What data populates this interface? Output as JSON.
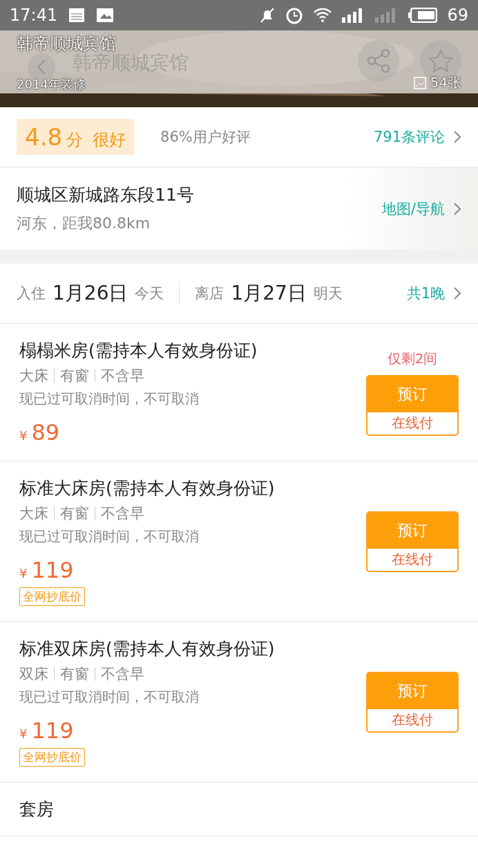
{
  "status_bar": {
    "time": "17:41",
    "battery": "69"
  },
  "header": {
    "hotel_name": "韩帝顺城宾馆",
    "renovated": "2014年装修",
    "title": "韩帝顺城宾馆",
    "photo_count": "54张"
  },
  "rating": {
    "score": "4.8",
    "unit": "分",
    "verdict": "很好",
    "positive": "86%用户好评",
    "reviews": "791条评论"
  },
  "address": {
    "street": "顺城区新城路东段11号",
    "area": "河东，距我80.8km",
    "map_link": "地图/导航"
  },
  "dates": {
    "checkin_label": "入住",
    "checkin_date": "1月26日",
    "checkin_day": "今天",
    "checkout_label": "离店",
    "checkout_date": "1月27日",
    "checkout_day": "明天",
    "nights": "共1晚"
  },
  "rooms": [
    {
      "name": "榻榻米房(需持本人有效身份证)",
      "features": [
        "大床",
        "有窗",
        "不含早"
      ],
      "policy": "现已过可取消时间，不可取消",
      "currency": "¥",
      "price": "89",
      "remaining": "仅剩2间",
      "book": "预订",
      "pay": "在线付"
    },
    {
      "name": "标准大床房(需持本人有效身份证)",
      "features": [
        "大床",
        "有窗",
        "不含早"
      ],
      "policy": "现已过可取消时间，不可取消",
      "currency": "¥",
      "price": "119",
      "badge": "全网抄底价",
      "book": "预订",
      "pay": "在线付"
    },
    {
      "name": "标准双床房(需持本人有效身份证)",
      "features": [
        "双床",
        "有窗",
        "不含早"
      ],
      "policy": "现已过可取消时间，不可取消",
      "currency": "¥",
      "price": "119",
      "badge": "全网抄底价",
      "book": "预订",
      "pay": "在线付"
    },
    {
      "name": "套房"
    }
  ]
}
